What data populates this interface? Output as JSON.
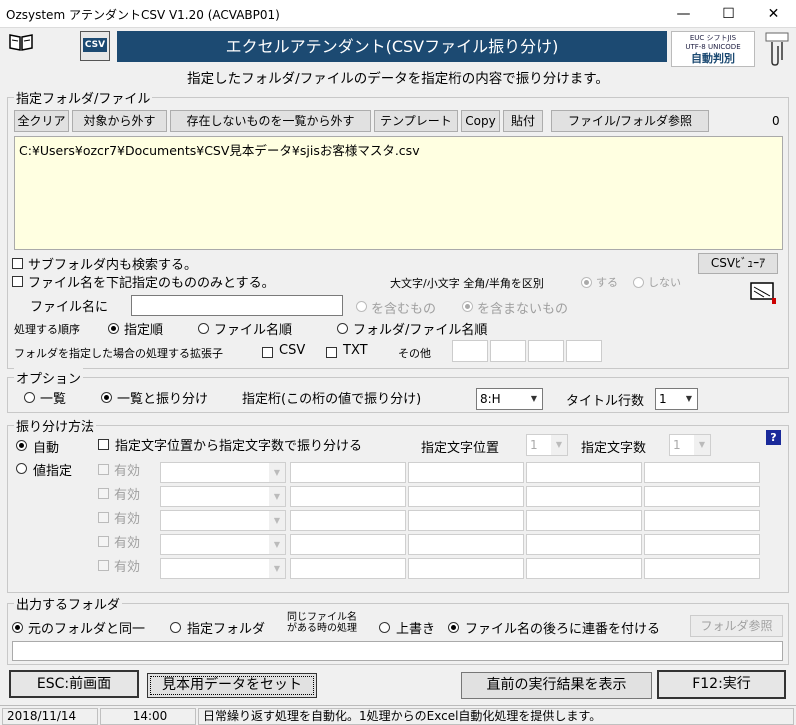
{
  "window": {
    "title": "Ozsystem アテンダントCSV V1.20 (ACVABP01)",
    "min": "—",
    "max": "☐",
    "close": "✕"
  },
  "header": {
    "banner": "エクセルアテンダント(CSVファイル振り分け)",
    "subtitle": "指定したフォルダ/ファイルのデータを指定桁の内容で振り分けます。",
    "csv_icon": "CSV",
    "logo_line1": "EUC シフトJIS",
    "logo_line2": "UTF-8 UNICODE",
    "logo_line3": "自動判別"
  },
  "files": {
    "legend": "指定フォルダ/ファイル",
    "buttons": [
      "全クリア",
      "対象から外す",
      "存在しないものを一覧から外す",
      "テンプレート",
      "Copy",
      "貼付",
      "ファイル/フォルダ参照"
    ],
    "count": "0",
    "path": "C:¥Users¥ozcr7¥Documents¥CSV見本データ¥sjisお客様マスタ.csv",
    "subfolder": "サブフォルダ内も検索する。",
    "filename_only": "ファイル名を下記指定のもののみとする。",
    "case_label": "大文字/小文字 全角/半角を区別",
    "case_yes": "する",
    "case_no": "しない",
    "csv_viewer": "CSVﾋﾞｭｰｱ",
    "filename_label": "ファイル名に",
    "include": "を含むもの",
    "exclude": "を含まないもの",
    "order_label": "処理する順序",
    "order": [
      "指定順",
      "ファイル名順",
      "フォルダ/ファイル名順"
    ],
    "ext_label": "フォルダを指定した場合の処理する拡張子",
    "ext_csv": "CSV",
    "ext_txt": "TXT",
    "ext_other": "その他"
  },
  "options": {
    "legend": "オプション",
    "list": "一覧",
    "list_split": "一覧と振り分け",
    "digit_label": "指定桁(この桁の値で振り分け)",
    "digit_value": "8:H",
    "title_rows_label": "タイトル行数",
    "title_rows": "1"
  },
  "split": {
    "legend": "振り分け方法",
    "auto": "自動",
    "value": "値指定",
    "by_pos": "指定文字位置から指定文字数で振り分ける",
    "pos_label": "指定文字位置",
    "pos_value": "1",
    "count_label": "指定文字数",
    "count_value": "1",
    "enabled": "有効",
    "help": "?"
  },
  "output": {
    "legend": "出力するフォルダ",
    "same": "元のフォルダと同一",
    "specified": "指定フォルダ",
    "same_name_1": "同じファイル名",
    "same_name_2": "がある時の処理",
    "overwrite": "上書き",
    "serial": "ファイル名の後ろに連番を付ける",
    "browse": "フォルダ参照"
  },
  "footer": {
    "esc": "ESC:前画面",
    "sample": "見本用データをセット",
    "last_result": "直前の実行結果を表示",
    "run": "F12:実行"
  },
  "status": {
    "date": "2018/11/14",
    "time": "14:00",
    "message": "日常繰り返す処理を自動化。1処理からのExcel自動化処理を提供します。"
  }
}
